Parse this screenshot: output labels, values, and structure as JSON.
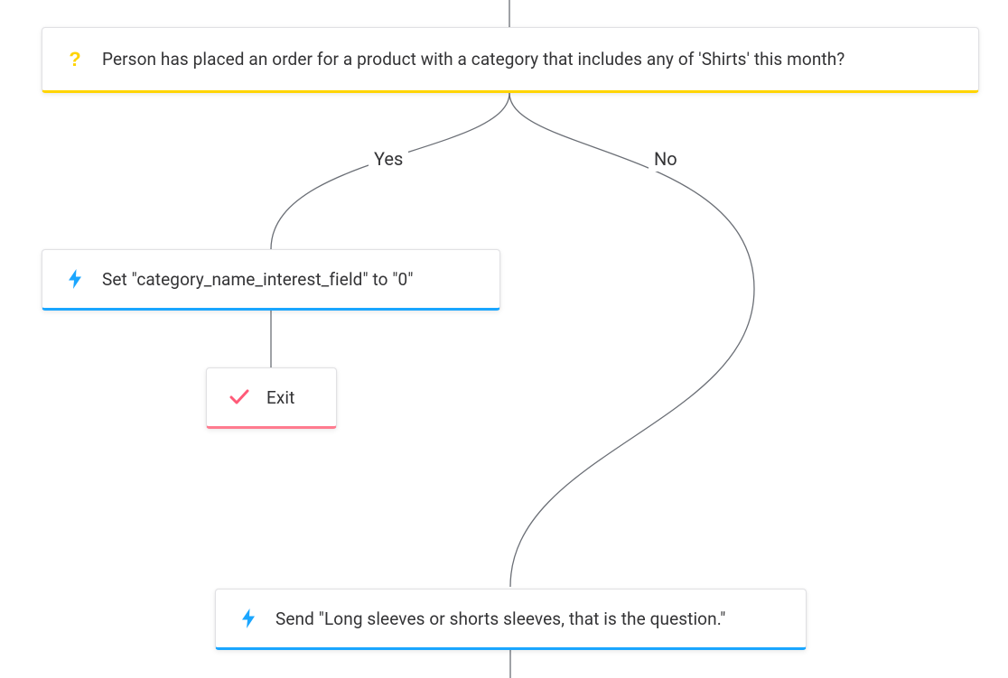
{
  "diagram": {
    "condition": {
      "text": "Person has placed an order for a product with a category that includes any of 'Shirts' this month?"
    },
    "branches": {
      "yes_label": "Yes",
      "no_label": "No"
    },
    "action_set": {
      "text": "Set \"category_name_interest_field\" to \"0\""
    },
    "exit": {
      "text": "Exit"
    },
    "action_send": {
      "text": "Send \"Long sleeves or shorts sleeves, that is the question.\""
    },
    "icons": {
      "question": "question-mark",
      "bolt": "lightning-bolt",
      "check": "check-mark"
    },
    "colors": {
      "condition_accent": "#ffd400",
      "action_accent": "#1aa6ff",
      "exit_accent": "#ff7b8f"
    }
  }
}
